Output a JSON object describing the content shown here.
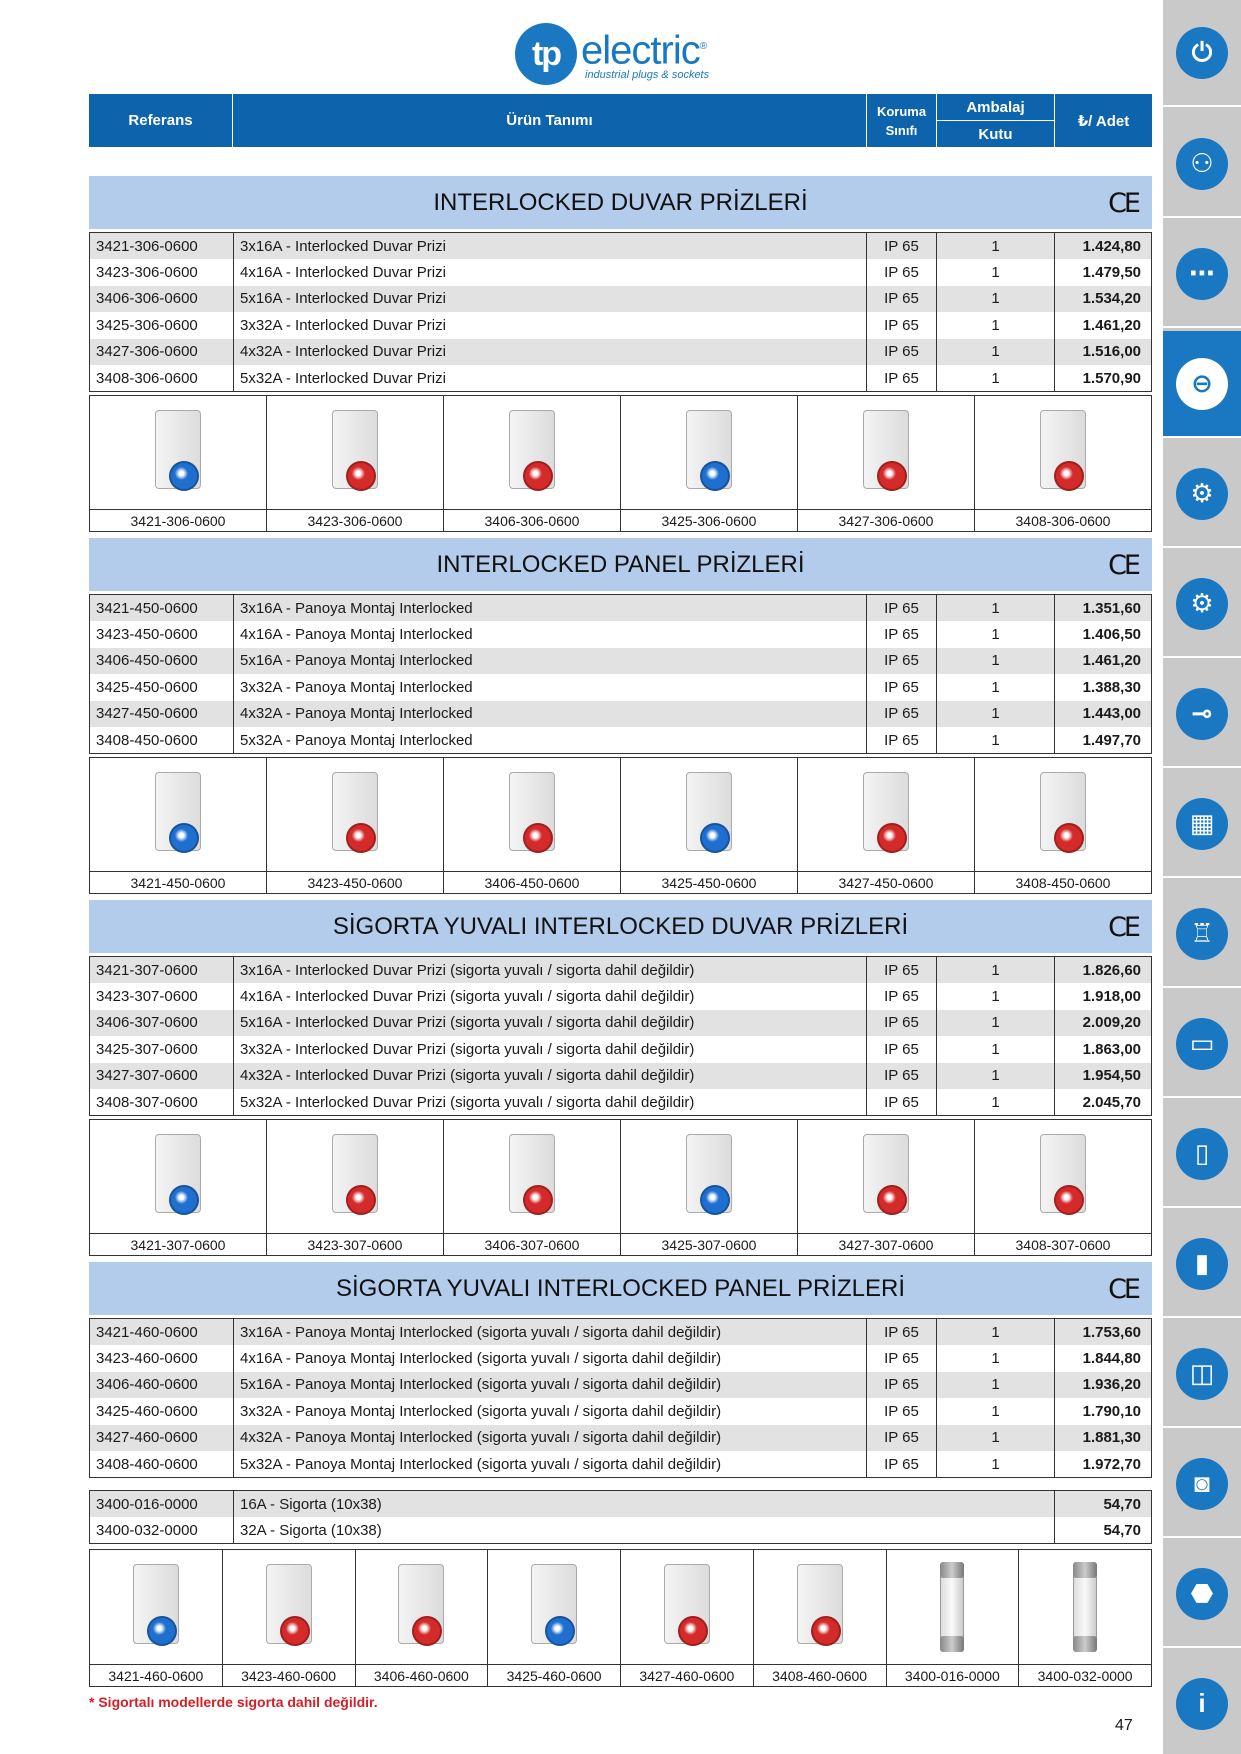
{
  "brand": {
    "badge": "tp",
    "word": "electric",
    "registered": "®",
    "tagline": "industrial plugs & sockets"
  },
  "header": {
    "ref": "Referans",
    "urun": "Ürün Tanımı",
    "koruma1": "Koruma",
    "koruma2": "Sınıfı",
    "ambalaj": "Ambalaj",
    "kutu": "Kutu",
    "adet": "₺/ Adet"
  },
  "ce_mark": "CE",
  "sections": [
    {
      "title": "INTERLOCKED DUVAR PRİZLERİ",
      "rows": [
        [
          "3421-306-0600",
          "3x16A - Interlocked Duvar Prizi",
          "IP 65",
          "1",
          "1.424,80"
        ],
        [
          "3423-306-0600",
          "4x16A - Interlocked Duvar Prizi",
          "IP 65",
          "1",
          "1.479,50"
        ],
        [
          "3406-306-0600",
          "5x16A - Interlocked Duvar Prizi",
          "IP 65",
          "1",
          "1.534,20"
        ],
        [
          "3425-306-0600",
          "3x32A - Interlocked Duvar Prizi",
          "IP 65",
          "1",
          "1.461,20"
        ],
        [
          "3427-306-0600",
          "4x32A - Interlocked Duvar Prizi",
          "IP 65",
          "1",
          "1.516,00"
        ],
        [
          "3408-306-0600",
          "5x32A - Interlocked Duvar Prizi",
          "IP 65",
          "1",
          "1.570,90"
        ]
      ],
      "images": [
        "3421-306-0600",
        "3423-306-0600",
        "3406-306-0600",
        "3425-306-0600",
        "3427-306-0600",
        "3408-306-0600"
      ]
    },
    {
      "title": "INTERLOCKED PANEL PRİZLERİ",
      "rows": [
        [
          "3421-450-0600",
          "3x16A - Panoya Montaj Interlocked",
          "IP 65",
          "1",
          "1.351,60"
        ],
        [
          "3423-450-0600",
          "4x16A - Panoya Montaj Interlocked",
          "IP 65",
          "1",
          "1.406,50"
        ],
        [
          "3406-450-0600",
          "5x16A - Panoya Montaj Interlocked",
          "IP 65",
          "1",
          "1.461,20"
        ],
        [
          "3425-450-0600",
          "3x32A - Panoya Montaj Interlocked",
          "IP 65",
          "1",
          "1.388,30"
        ],
        [
          "3427-450-0600",
          "4x32A - Panoya Montaj Interlocked",
          "IP 65",
          "1",
          "1.443,00"
        ],
        [
          "3408-450-0600",
          "5x32A - Panoya Montaj Interlocked",
          "IP 65",
          "1",
          "1.497,70"
        ]
      ],
      "images": [
        "3421-450-0600",
        "3423-450-0600",
        "3406-450-0600",
        "3425-450-0600",
        "3427-450-0600",
        "3408-450-0600"
      ]
    },
    {
      "title": "SİGORTA YUVALI INTERLOCKED DUVAR PRİZLERİ",
      "rows": [
        [
          "3421-307-0600",
          "3x16A - Interlocked Duvar Prizi (sigorta yuvalı / sigorta dahil değildir)",
          "IP 65",
          "1",
          "1.826,60"
        ],
        [
          "3423-307-0600",
          "4x16A - Interlocked Duvar Prizi (sigorta yuvalı / sigorta dahil değildir)",
          "IP 65",
          "1",
          "1.918,00"
        ],
        [
          "3406-307-0600",
          "5x16A - Interlocked Duvar Prizi (sigorta yuvalı / sigorta dahil değildir)",
          "IP 65",
          "1",
          "2.009,20"
        ],
        [
          "3425-307-0600",
          "3x32A - Interlocked Duvar Prizi (sigorta yuvalı / sigorta dahil değildir)",
          "IP 65",
          "1",
          "1.863,00"
        ],
        [
          "3427-307-0600",
          "4x32A - Interlocked Duvar Prizi (sigorta yuvalı / sigorta dahil değildir)",
          "IP 65",
          "1",
          "1.954,50"
        ],
        [
          "3408-307-0600",
          "5x32A - Interlocked Duvar Prizi (sigorta yuvalı / sigorta dahil değildir)",
          "IP 65",
          "1",
          "2.045,70"
        ]
      ],
      "images": [
        "3421-307-0600",
        "3423-307-0600",
        "3406-307-0600",
        "3425-307-0600",
        "3427-307-0600",
        "3408-307-0600"
      ]
    },
    {
      "title": "SİGORTA YUVALI INTERLOCKED PANEL PRİZLERİ",
      "rows": [
        [
          "3421-460-0600",
          "3x16A - Panoya Montaj Interlocked (sigorta yuvalı / sigorta dahil değildir)",
          "IP 65",
          "1",
          "1.753,60"
        ],
        [
          "3423-460-0600",
          "4x16A - Panoya Montaj Interlocked (sigorta yuvalı / sigorta dahil değildir)",
          "IP 65",
          "1",
          "1.844,80"
        ],
        [
          "3406-460-0600",
          "5x16A - Panoya Montaj Interlocked (sigorta yuvalı / sigorta dahil değildir)",
          "IP 65",
          "1",
          "1.936,20"
        ],
        [
          "3425-460-0600",
          "3x32A - Panoya Montaj Interlocked (sigorta yuvalı / sigorta dahil değildir)",
          "IP 65",
          "1",
          "1.790,10"
        ],
        [
          "3427-460-0600",
          "4x32A - Panoya Montaj Interlocked (sigorta yuvalı / sigorta dahil değildir)",
          "IP 65",
          "1",
          "1.881,30"
        ],
        [
          "3408-460-0600",
          "5x32A - Panoya Montaj Interlocked (sigorta yuvalı / sigorta dahil değildir)",
          "IP 65",
          "1",
          "1.972,70"
        ]
      ]
    }
  ],
  "fuses": [
    [
      "3400-016-0000",
      "16A - Sigorta (10x38)",
      "54,70"
    ],
    [
      "3400-032-0000",
      "32A - Sigorta (10x38)",
      "54,70"
    ]
  ],
  "last_images": [
    "3421-460-0600",
    "3423-460-0600",
    "3406-460-0600",
    "3425-460-0600",
    "3427-460-0600",
    "3408-460-0600",
    "3400-016-0000",
    "3400-032-0000"
  ],
  "note": "* Sigortalı modellerde sigorta dahil değildir.",
  "page_number": "47",
  "colors": {
    "primary": "#0d64ad",
    "section_bg": "#b4ccec",
    "socket_blue": "#1f6fd0",
    "socket_red": "#d42a2a",
    "note_red": "#d41f26"
  },
  "sidebar_icons": [
    "plug-icon",
    "socket-icon",
    "connector-strip-icon",
    "interlocked-socket-icon",
    "five-pin-socket-icon",
    "five-pin-socket-alt-icon",
    "panel-plug-icon",
    "distribution-board-icon",
    "socket-combination-icon",
    "box-icon",
    "double-socket-icon",
    "junction-box-icon",
    "enclosure-icon",
    "round-box-icon",
    "cable-box-icon",
    "info-icon"
  ],
  "sidebar_glyphs": [
    "⏻",
    "⚇",
    "⋯",
    "⊖",
    "⚙",
    "⚙",
    "⊸",
    "▦",
    "♖",
    "▭",
    "▯",
    "▮",
    "◫",
    "◙",
    "⬣",
    "i"
  ]
}
